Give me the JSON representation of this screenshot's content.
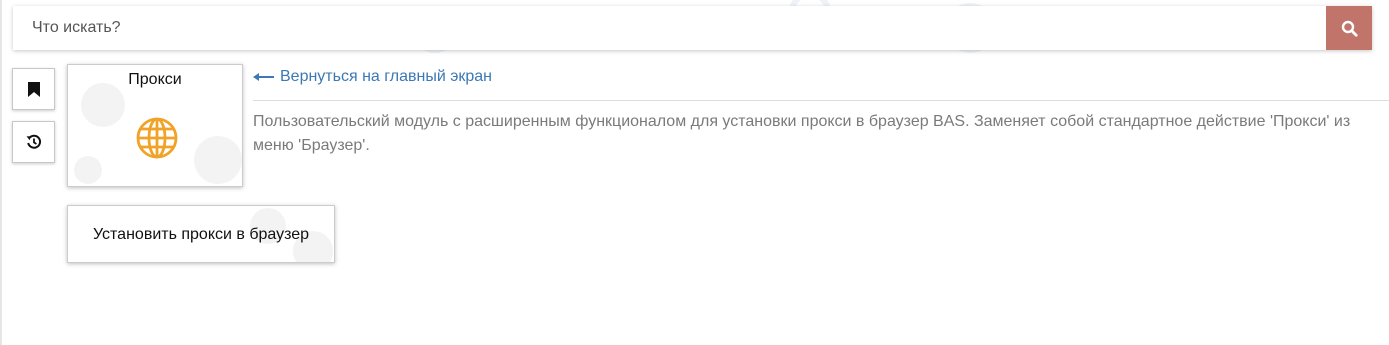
{
  "search": {
    "placeholder": "Что искать?",
    "icon": "search-icon"
  },
  "sidebar": {
    "buttons": [
      {
        "icon": "bookmark-icon"
      },
      {
        "icon": "history-icon"
      }
    ]
  },
  "module": {
    "title": "Прокси",
    "icon": "globe-icon"
  },
  "back_link": {
    "label": "Вернуться на главный экран"
  },
  "description": "Пользовательский модуль с расширенным функционалом для установки прокси в браузер BAS. Заменяет собой стандартное действие 'Прокси' из меню 'Браузер'.",
  "actions": [
    {
      "label": "Установить прокси в браузер"
    }
  ],
  "colors": {
    "accent": "#c0746a",
    "link": "#3c78b5",
    "description_text": "#7a7a7a",
    "globe": "#f0a326"
  }
}
